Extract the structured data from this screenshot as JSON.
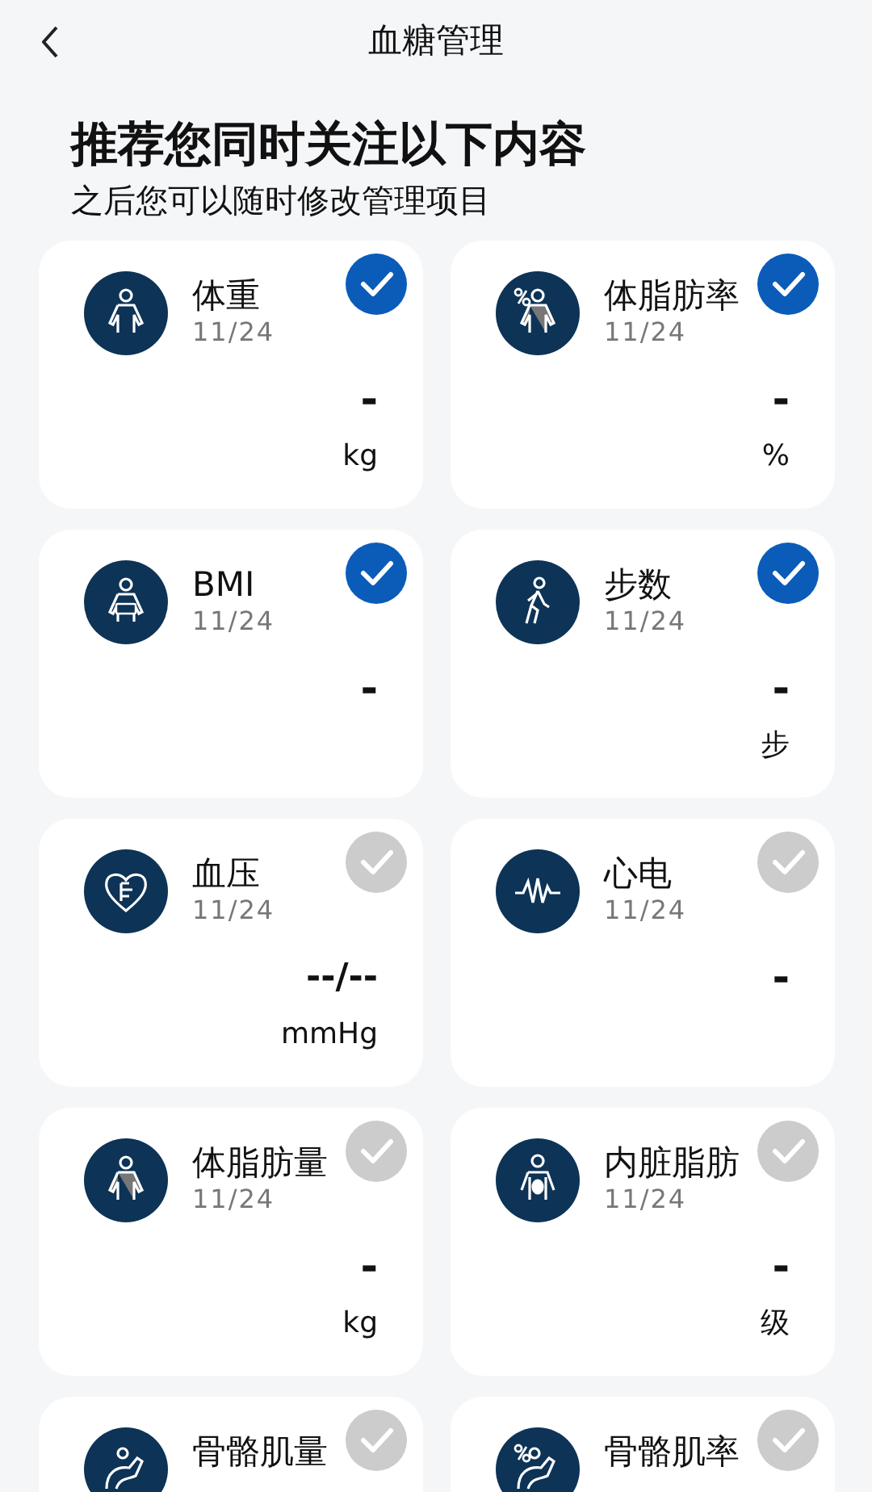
{
  "header": {
    "title": "血糖管理"
  },
  "heading": "推荐您同时关注以下内容",
  "subheading": "之后您可以随时修改管理项目",
  "items": [
    {
      "name": "体重",
      "date": "11/24",
      "value": "-",
      "unit": "kg",
      "checked": true
    },
    {
      "name": "体脂肪率",
      "date": "11/24",
      "value": "-",
      "unit": "%",
      "checked": true
    },
    {
      "name": "BMI",
      "date": "11/24",
      "value": "-",
      "checked": true
    },
    {
      "name": "步数",
      "date": "11/24",
      "value": "-",
      "unit": "步",
      "checked": true
    },
    {
      "name": "血压",
      "date": "11/24",
      "value": "--/--",
      "unit": "mmHg",
      "checked": false
    },
    {
      "name": "心电",
      "date": "11/24",
      "value": "-",
      "checked": false
    },
    {
      "name": "体脂肪量",
      "date": "11/24",
      "value": "-",
      "unit": "kg",
      "checked": false
    },
    {
      "name": "内脏脂肪",
      "date": "11/24",
      "value": "-",
      "unit": "级",
      "checked": false
    },
    {
      "name": "骨骼肌量",
      "checked": false
    },
    {
      "name": "骨骼肌率",
      "checked": false
    }
  ]
}
